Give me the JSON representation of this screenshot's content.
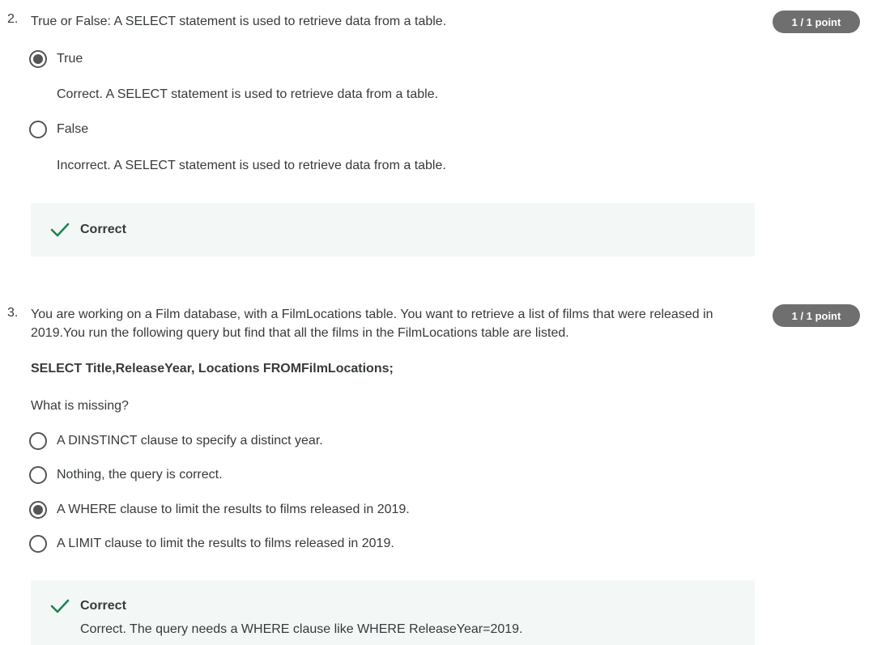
{
  "questions": [
    {
      "number": "2.",
      "prompt": "True or False: A SELECT statement is used to retrieve data from a table.",
      "points": "1 / 1 point",
      "options": [
        {
          "label": "True",
          "selected": true,
          "feedback": "Correct. A SELECT statement is used to retrieve data from a table."
        },
        {
          "label": "False",
          "selected": false,
          "feedback": "Incorrect. A SELECT statement is used to retrieve data from a table."
        }
      ],
      "result": {
        "title": "Correct",
        "explanation": ""
      }
    },
    {
      "number": "3.",
      "prompt": "You are working on a Film database, with a FilmLocations table. You want to retrieve a list of films that were released in 2019.You run the following query but find that all the films in the FilmLocations table are listed.",
      "points": "1 / 1 point",
      "code": "SELECT Title,ReleaseYear, Locations FROMFilmLocations;",
      "sub_prompt": "What is missing?",
      "options": [
        {
          "label": "A DINSTINCT clause to specify a distinct year.",
          "selected": false
        },
        {
          "label": "Nothing, the query is correct.",
          "selected": false
        },
        {
          "label": "A WHERE clause to limit the results to films released in 2019.",
          "selected": true
        },
        {
          "label": "A LIMIT clause to limit the results to films released in 2019.",
          "selected": false
        }
      ],
      "result": {
        "title": "Correct",
        "explanation": "Correct. The query needs a WHERE clause like WHERE ReleaseYear=2019."
      }
    }
  ],
  "colors": {
    "badge_bg": "#6f6f6f",
    "result_bg": "#f3f8f6",
    "check_green": "#1f8354",
    "text": "#373a3c"
  },
  "icons": {
    "radio_selected": "radio-checked-icon",
    "radio_unselected": "radio-unchecked-icon",
    "correct": "checkmark-icon"
  }
}
